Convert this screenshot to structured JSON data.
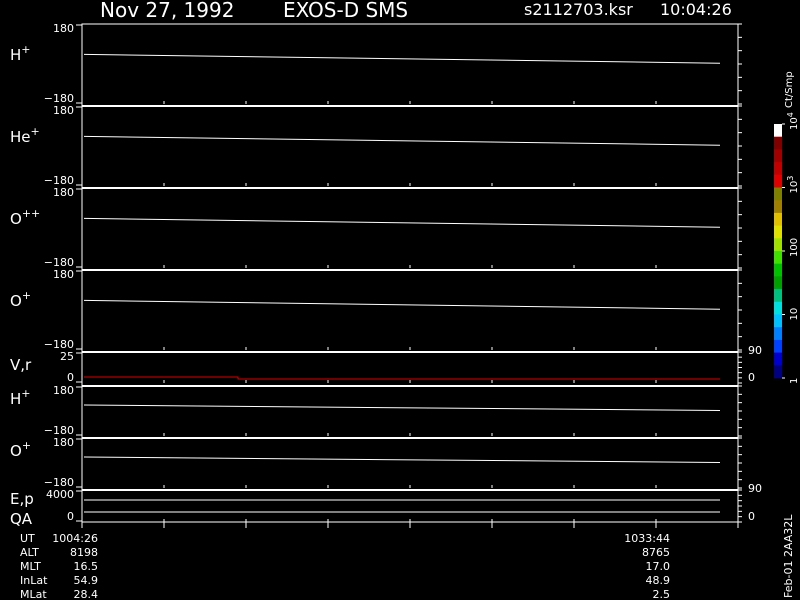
{
  "header": {
    "date": "Nov 27, 1992",
    "instrument": "EXOS-D SMS",
    "file": "s2112703.ksr",
    "time": "10:04:26"
  },
  "colorbar": {
    "unit": "Ct/Smp",
    "ticks": [
      {
        "label": "1",
        "value": 1
      },
      {
        "label": "10",
        "value": 10
      },
      {
        "label": "100",
        "value": 100
      },
      {
        "label": "10^3",
        "value": 1000
      },
      {
        "label": "10^4",
        "value": 10000
      }
    ],
    "colors": [
      "#000080",
      "#0000cc",
      "#0040ff",
      "#0080ff",
      "#00c0ff",
      "#00e0e0",
      "#00c080",
      "#00a000",
      "#00c000",
      "#40e000",
      "#a0e000",
      "#e0e000",
      "#e0c000",
      "#a08000",
      "#808000",
      "#e00000",
      "#c00000",
      "#a00000",
      "#800000",
      "#ffffff"
    ]
  },
  "chart_data": {
    "type": "line",
    "x_start": "1004:26",
    "x_end": "1033:44",
    "panels": [
      {
        "label": "H",
        "sup": "+",
        "ymax": "180",
        "ymin": "−180",
        "right": [],
        "y": [
          0.1,
          0.5
        ],
        "color": "#ffffff"
      },
      {
        "label": "He",
        "sup": "+",
        "ymax": "180",
        "ymin": "−180",
        "right": [],
        "y": [
          0.1,
          0.5
        ],
        "color": "#ffffff"
      },
      {
        "label": "O",
        "sup": "++",
        "ymax": "180",
        "ymin": "−180",
        "right": [],
        "y": [
          0.1,
          0.5
        ],
        "color": "#ffffff"
      },
      {
        "label": "O",
        "sup": "+",
        "ymax": "180",
        "ymin": "−180",
        "right": [],
        "y": [
          0.1,
          0.5
        ],
        "color": "#ffffff"
      },
      {
        "label": "V,r",
        "sup": "",
        "ymax": "25",
        "ymin": "0",
        "right": [
          "90",
          "0"
        ],
        "y": [
          0.0,
          0.0
        ],
        "color": "#e00000"
      },
      {
        "label": "H",
        "sup": "+",
        "ymax": "180",
        "ymin": "−180",
        "right": [],
        "y": [
          0.1,
          0.5
        ],
        "color": "#ffffff"
      },
      {
        "label": "O",
        "sup": "+",
        "ymax": "180",
        "ymin": "−180",
        "right": [],
        "y": [
          0.1,
          0.5
        ],
        "color": "#ffffff"
      },
      {
        "label": "E,p",
        "sup": "",
        "label2": "QA",
        "ymax": "4000",
        "ymin": "0",
        "right": [
          "90",
          "0"
        ],
        "y": [
          0.0,
          0.0
        ],
        "color": "#ffffff"
      }
    ],
    "ephemeris": [
      {
        "name": "UT",
        "start": "1004:26",
        "end": "1033:44"
      },
      {
        "name": "ALT",
        "start": "8198",
        "end": "8765"
      },
      {
        "name": "MLT",
        "start": "16.5",
        "end": "17.0"
      },
      {
        "name": "InLat",
        "start": "54.9",
        "end": "48.9"
      },
      {
        "name": "MLat",
        "start": "28.4",
        "end": "2.5"
      }
    ]
  },
  "footer": {
    "stamp": "Feb-01 2AA32L"
  }
}
